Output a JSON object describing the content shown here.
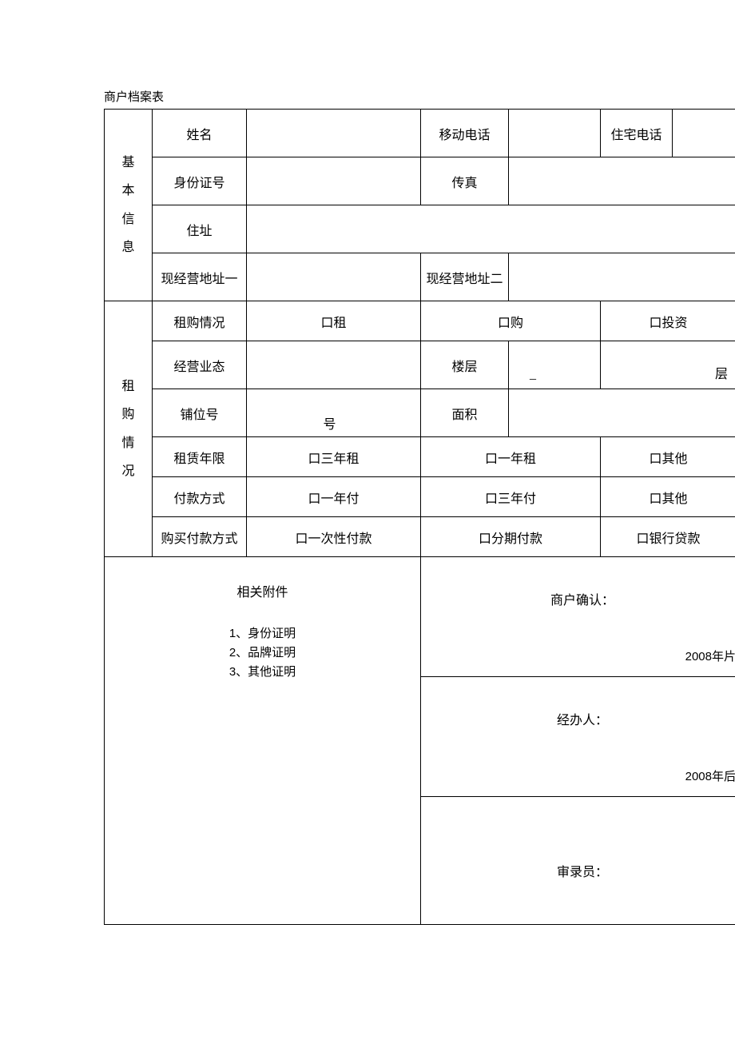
{
  "title": "商户档案表",
  "sections": {
    "basic": "基本信息",
    "rent": "租购情况"
  },
  "basic": {
    "name": "姓名",
    "mobile": "移动电话",
    "homePhone": "住宅电话",
    "idNo": "身份证号",
    "fax": "传真",
    "address": "住址",
    "bizAddr1": "现经营地址一",
    "bizAddr2": "现经营地址二"
  },
  "rent": {
    "situation": "租购情况",
    "optRent": "口租",
    "optBuy": "口购",
    "optInvest": "口投资",
    "bizType": "经营业态",
    "floor": "楼层",
    "floorSuffix": "层",
    "underscore": "_",
    "shopNo": "铺位号",
    "shopNoSuffix": "号",
    "area": "面积",
    "leaseYears": "租赁年限",
    "lease3y": "口三年租",
    "lease1y": "口一年租",
    "leaseOther": "口其他",
    "payMethod": "付款方式",
    "pay1y": "口一年付",
    "pay3y": "口三年付",
    "payOther": "口其他",
    "buyPay": "购买付款方式",
    "buyOnce": "口一次性付款",
    "buyInstall": "口分期付款",
    "buyLoan": "口银行贷款"
  },
  "attachments": {
    "title": "相关附件",
    "item1": "1、身份证明",
    "item2": "2、品牌证明",
    "item3": "3、其他证明"
  },
  "signatures": {
    "confirm": "商户确认：",
    "confirmDate": "2008年片",
    "handler": "经办人：",
    "handlerDate": "2008年后",
    "reviewer": "审录员："
  }
}
